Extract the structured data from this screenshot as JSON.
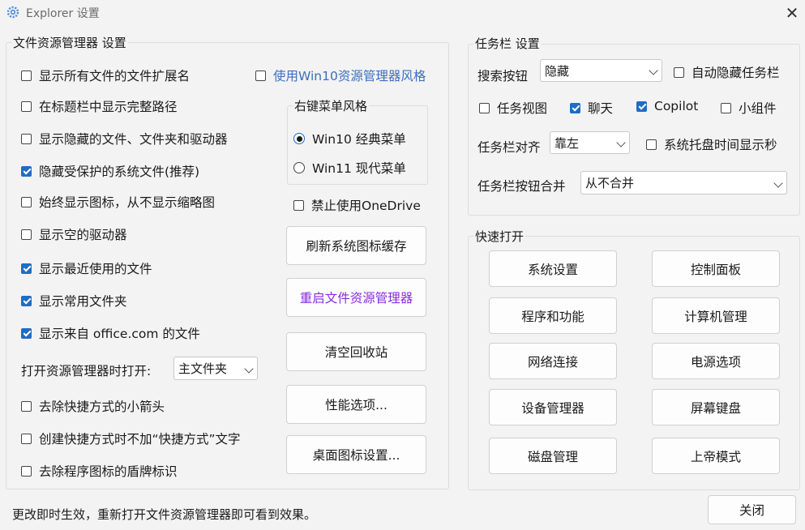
{
  "window": {
    "title": "Explorer 设置"
  },
  "explorer": {
    "title": "文件资源管理器 设置",
    "options": [
      {
        "label": "显示所有文件的文件扩展名",
        "checked": false
      },
      {
        "label": "在标题栏中显示完整路径",
        "checked": false
      },
      {
        "label": "显示隐藏的文件、文件夹和驱动器",
        "checked": false
      },
      {
        "label": "隐藏受保护的系统文件(推荐)",
        "checked": true
      },
      {
        "label": "始终显示图标，从不显示缩略图",
        "checked": false
      },
      {
        "label": "显示空的驱动器",
        "checked": false
      },
      {
        "label": "显示最近使用的文件",
        "checked": true
      },
      {
        "label": "显示常用文件夹",
        "checked": true
      },
      {
        "label": "显示来自 office.com 的文件",
        "checked": true
      }
    ],
    "open_label": "打开资源管理器时打开:",
    "open_value": "主文件夹",
    "shortcut_options": [
      {
        "label": "去除快捷方式的小箭头",
        "checked": false
      },
      {
        "label": "创建快捷方式时不加“快捷方式”文字",
        "checked": false
      },
      {
        "label": "去除程序图标的盾牌标识",
        "checked": false
      }
    ],
    "win10_style": {
      "label": "使用Win10资源管理器风格",
      "checked": false
    },
    "context_menu": {
      "title": "右键菜单风格",
      "win10": "Win10 经典菜单",
      "win11": "Win11 现代菜单",
      "selected": "win10"
    },
    "onedrive": {
      "label": "禁止使用OneDrive",
      "checked": false
    },
    "buttons": {
      "refresh_icons": "刷新系统图标缓存",
      "restart_explorer": "重启文件资源管理器",
      "empty_recycle": "清空回收站",
      "performance": "性能选项...",
      "desktop_icons": "桌面图标设置..."
    }
  },
  "taskbar": {
    "title": "任务栏 设置",
    "search_label": "搜索按钮",
    "search_value": "隐藏",
    "auto_hide": {
      "label": "自动隐藏任务栏",
      "checked": false
    },
    "task_view": {
      "label": "任务视图",
      "checked": false
    },
    "chat": {
      "label": "聊天",
      "checked": true
    },
    "copilot": {
      "label": "Copilot",
      "checked": true
    },
    "widgets": {
      "label": "小组件",
      "checked": false
    },
    "align_label": "任务栏对齐",
    "align_value": "靠左",
    "tray_seconds": {
      "label": "系统托盘时间显示秒",
      "checked": false
    },
    "combine_label": "任务栏按钮合并",
    "combine_value": "从不合并"
  },
  "quick": {
    "title": "快速打开",
    "items": [
      "系统设置",
      "控制面板",
      "程序和功能",
      "计算机管理",
      "网络连接",
      "电源选项",
      "设备管理器",
      "屏幕键盘",
      "磁盘管理",
      "上帝模式"
    ]
  },
  "footer": {
    "status": "更改即时生效，重新打开文件资源管理器即可看到效果。",
    "close_label": "关闭"
  },
  "colors": {
    "accent": "#1f6dc4",
    "link": "#3a6fc0",
    "purple": "#8a2be2"
  }
}
